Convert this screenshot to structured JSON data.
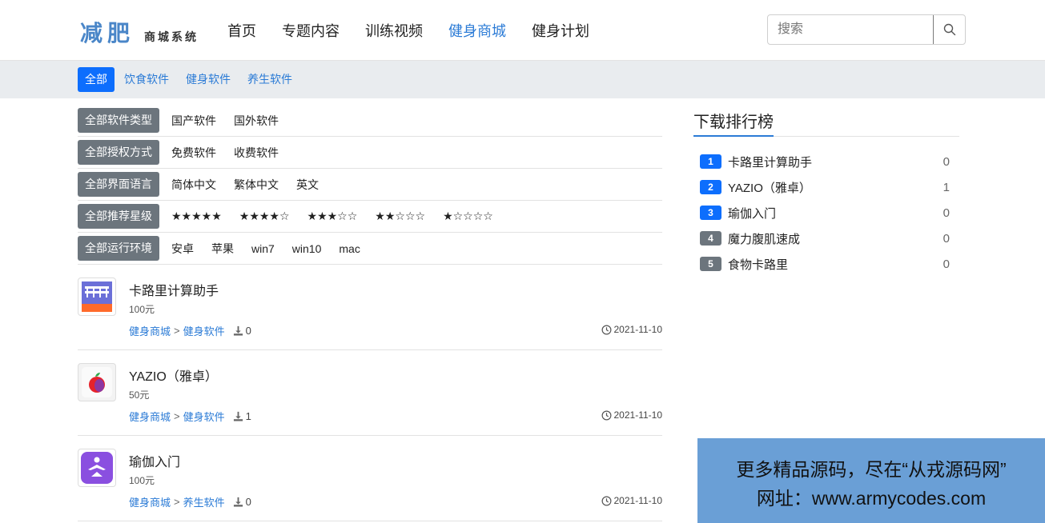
{
  "logo": {
    "big": "减肥",
    "small": "商城系统"
  },
  "nav": [
    {
      "label": "首页",
      "active": false
    },
    {
      "label": "专题内容",
      "active": false
    },
    {
      "label": "训练视频",
      "active": false
    },
    {
      "label": "健身商城",
      "active": true
    },
    {
      "label": "健身计划",
      "active": false
    }
  ],
  "search": {
    "placeholder": "搜索"
  },
  "categories": [
    {
      "label": "全部",
      "active": true
    },
    {
      "label": "饮食软件",
      "active": false
    },
    {
      "label": "健身软件",
      "active": false
    },
    {
      "label": "养生软件",
      "active": false
    }
  ],
  "filters": [
    {
      "tag": "全部软件类型",
      "options": [
        "国产软件",
        "国外软件"
      ]
    },
    {
      "tag": "全部授权方式",
      "options": [
        "免费软件",
        "收费软件"
      ]
    },
    {
      "tag": "全部界面语言",
      "options": [
        "简体中文",
        "繁体中文",
        "英文"
      ]
    },
    {
      "tag": "全部推荐星级",
      "options": [
        "★★★★★",
        "★★★★☆",
        "★★★☆☆",
        "★★☆☆☆",
        "★☆☆☆☆"
      ]
    },
    {
      "tag": "全部运行环境",
      "options": [
        "安卓",
        "苹果",
        "win7",
        "win10",
        "mac"
      ]
    }
  ],
  "software": [
    {
      "name": "卡路里计算助手",
      "price": "100元",
      "crumb1": "健身商城",
      "crumb2": "健身软件",
      "downloads": "0",
      "date": "2021-11-10",
      "icon": "calorie-app-icon"
    },
    {
      "name": "YAZIO（雅卓）",
      "price": "50元",
      "crumb1": "健身商城",
      "crumb2": "健身软件",
      "downloads": "1",
      "date": "2021-11-10",
      "icon": "yazio-app-icon"
    },
    {
      "name": "瑜伽入门",
      "price": "100元",
      "crumb1": "健身商城",
      "crumb2": "养生软件",
      "downloads": "0",
      "date": "2021-11-10",
      "icon": "yoga-app-icon"
    }
  ],
  "ranking": {
    "title": "下载排行榜",
    "items": [
      {
        "rank": "1",
        "name": "卡路里计算助手",
        "count": "0",
        "highlight": true
      },
      {
        "rank": "2",
        "name": "YAZIO（雅卓）",
        "count": "1",
        "highlight": true
      },
      {
        "rank": "3",
        "name": "瑜伽入门",
        "count": "0",
        "highlight": true
      },
      {
        "rank": "4",
        "name": "魔力腹肌速成",
        "count": "0",
        "highlight": false
      },
      {
        "rank": "5",
        "name": "食物卡路里",
        "count": "0",
        "highlight": false
      }
    ]
  },
  "banner": {
    "line1": "更多精品源码，尽在“从戎源码网”",
    "line2": "网址：www.armycodes.com"
  },
  "colors": {
    "accent": "#2b7bd6",
    "primary": "#0d6efd",
    "tag_gray": "#6c757d",
    "catbar_bg": "#e9ecef",
    "banner_bg": "#6a9fd6"
  }
}
